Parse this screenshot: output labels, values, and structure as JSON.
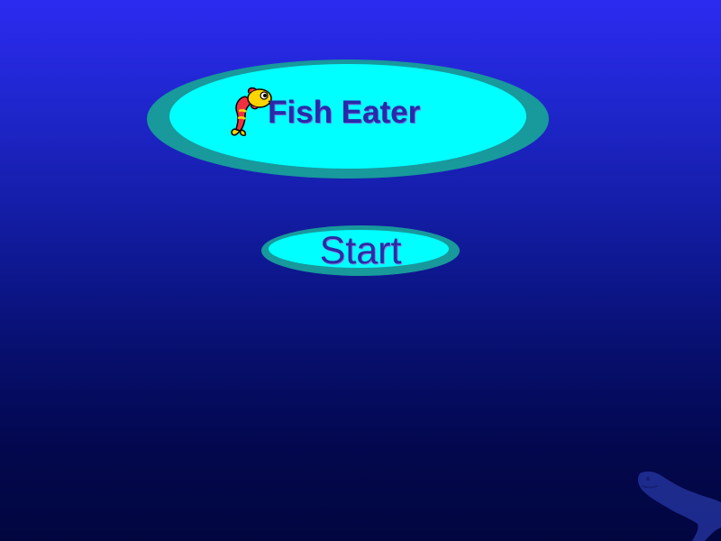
{
  "title": {
    "text": "Fish Eater",
    "icon": "fish-icon"
  },
  "start_button": {
    "label": "Start"
  },
  "background": {
    "decoration": "shark-silhouette-icon"
  },
  "colors": {
    "background_top": "#2b2bf0",
    "background_bottom": "#02063f",
    "plate_outer": "#18999c",
    "plate_inner": "#00ffff",
    "text": "#2a2aa8"
  }
}
